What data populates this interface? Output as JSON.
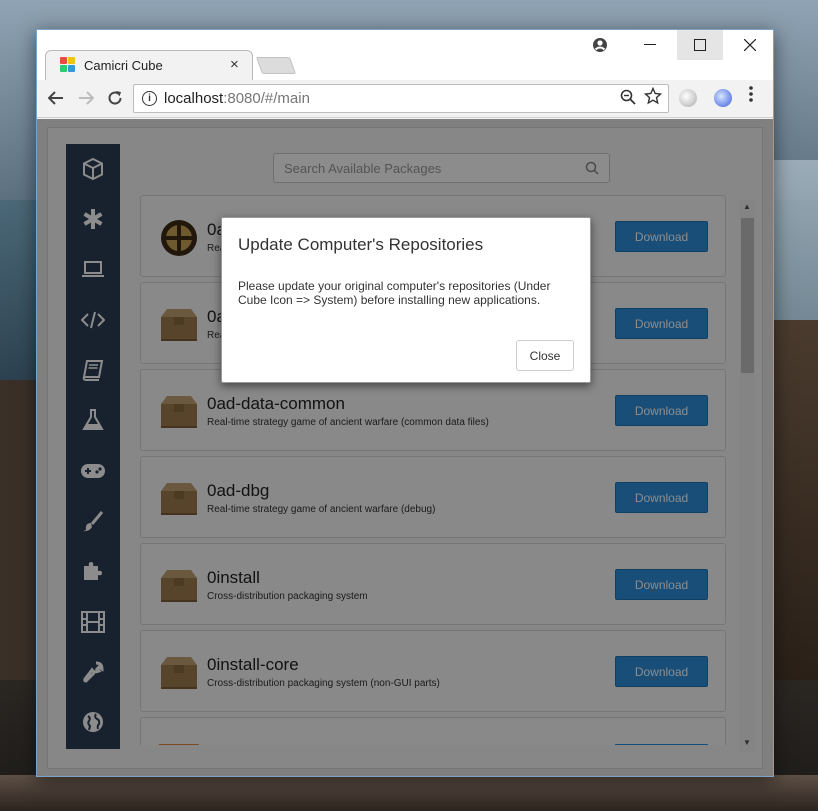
{
  "browser": {
    "tab_title": "Camicri Cube",
    "tab_close": "×",
    "url_host": "localhost",
    "url_rest": ":8080/#/main",
    "info_symbol": "i"
  },
  "search": {
    "placeholder": "Search Available Packages"
  },
  "sidebar": {
    "items": [
      {
        "icon": "cube-icon"
      },
      {
        "icon": "asterisk-icon"
      },
      {
        "icon": "laptop-icon"
      },
      {
        "icon": "code-icon"
      },
      {
        "icon": "book-icon"
      },
      {
        "icon": "flask-icon"
      },
      {
        "icon": "gamepad-icon"
      },
      {
        "icon": "paintbrush-icon"
      },
      {
        "icon": "puzzle-icon"
      },
      {
        "icon": "film-icon"
      },
      {
        "icon": "wrench-icon"
      },
      {
        "icon": "globe-icon"
      }
    ]
  },
  "packages": [
    {
      "name": "0a",
      "desc": "Rea",
      "icon": "game-logo-icon",
      "button": "Download"
    },
    {
      "name": "0a",
      "desc": "Rea",
      "icon": "package-box-icon",
      "button": "Download"
    },
    {
      "name": "0ad-data-common",
      "desc": "Real-time strategy game of ancient warfare (common data files)",
      "icon": "package-box-icon",
      "button": "Download"
    },
    {
      "name": "0ad-dbg",
      "desc": "Real-time strategy game of ancient warfare (debug)",
      "icon": "package-box-icon",
      "button": "Download"
    },
    {
      "name": "0install",
      "desc": "Cross-distribution packaging system",
      "icon": "package-box-icon",
      "button": "Download"
    },
    {
      "name": "0install-core",
      "desc": "Cross-distribution packaging system (non-GUI parts)",
      "icon": "package-box-icon",
      "button": "Download"
    }
  ],
  "modal": {
    "title": "Update Computer's Repositories",
    "body": "Please update your original computer's repositories (Under Cube Icon => System) before installing new applications.",
    "close_label": "Close"
  },
  "colors": {
    "sidebar": "#2c3e55",
    "download_button": "#2d8fd9",
    "box": "#a07b4f"
  }
}
